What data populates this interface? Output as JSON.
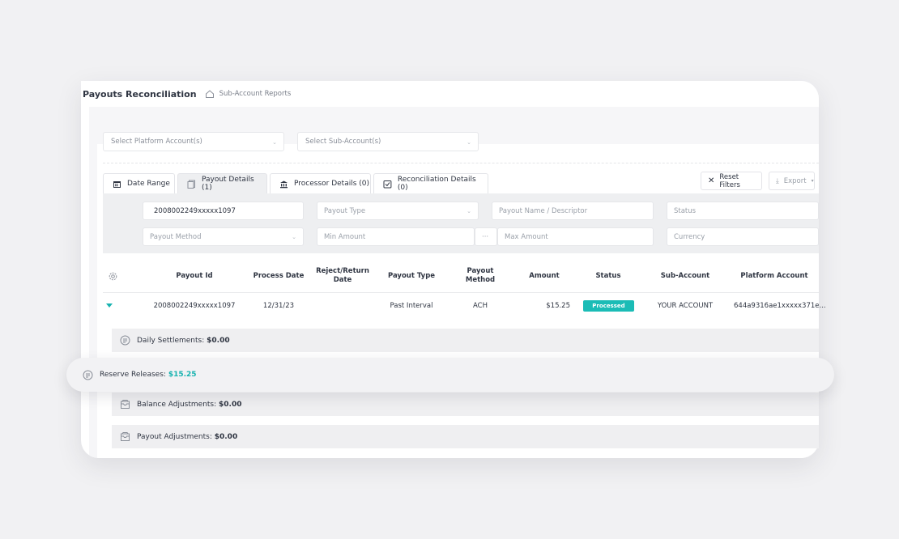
{
  "header": {
    "title": "Payouts Reconciliation",
    "breadcrumb": "Sub-Account Reports"
  },
  "selects": {
    "platform_account": "Select Platform Account(s)",
    "sub_account": "Select Sub-Account(s)"
  },
  "tabs": [
    {
      "label": "Date Range",
      "icon": "calendar-icon"
    },
    {
      "label": "Payout Details (1)",
      "icon": "document-icon"
    },
    {
      "label": "Processor Details (0)",
      "icon": "bank-icon"
    },
    {
      "label": "Reconciliation Details (0)",
      "icon": "checklist-icon"
    }
  ],
  "actions": {
    "reset_filters": "Reset Filters",
    "export": "Export"
  },
  "filters": {
    "payout_id_value": "2008002249xxxxx1097",
    "payout_type": "Payout Type",
    "payout_name": "Payout Name / Descriptor",
    "status": "Status",
    "payout_method": "Payout Method",
    "min_amount": "Min Amount",
    "range_sep": "···",
    "max_amount": "Max Amount",
    "currency": "Currency"
  },
  "table": {
    "columns": {
      "payout_id": "Payout Id",
      "process_date": "Process Date",
      "reject_date_1": "Reject/Return",
      "reject_date_2": "Date",
      "payout_type": "Payout Type",
      "payout_method_1": "Payout",
      "payout_method_2": "Method",
      "amount": "Amount",
      "status": "Status",
      "sub_account": "Sub-Account",
      "platform_account": "Platform Account"
    },
    "row": {
      "payout_id": "2008002249xxxxx1097",
      "process_date": "12/31/23",
      "payout_type": "Past Interval",
      "payout_method": "ACH",
      "amount": "$15.25",
      "status": "Processed",
      "sub_account": "YOUR ACCOUNT",
      "platform_account": "644a9316ae1xxxxx371e..."
    }
  },
  "summary": {
    "daily_label": "Daily Settlements:",
    "daily_value": "$0.00",
    "reserve_label": "Reserve Releases:",
    "reserve_value": "$15.25",
    "balance_label": "Balance Adjustments:",
    "balance_value": "$0.00",
    "payout_adj_label": "Payout Adjustments:",
    "payout_adj_value": "$0.00"
  },
  "colors": {
    "accent": "#1bbcb6",
    "text": "#2f3542",
    "muted": "#9aa0a9"
  }
}
